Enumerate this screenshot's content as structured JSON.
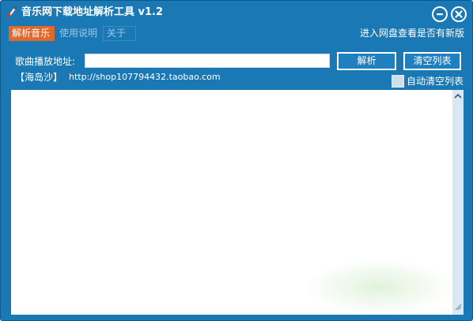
{
  "window": {
    "title": "音乐网下载地址解析工具 v1.2",
    "colors": {
      "frame": "#1a78b4",
      "active_tab": "#e0682a",
      "list_bg": "#ffffff"
    }
  },
  "title_controls": {
    "minimize_icon": "minimize-icon",
    "close_icon": "close-icon"
  },
  "tabs": [
    {
      "label": "解析音乐",
      "active": true
    },
    {
      "label": "使用说明",
      "active": false
    },
    {
      "label": "关于",
      "active": false
    }
  ],
  "update_link": "进入网盘查看是否有新版",
  "form": {
    "url_label": "歌曲播放地址:",
    "url_value": "",
    "parse_button": "解析",
    "clear_button": "清空列表"
  },
  "shop": {
    "name": "【海岛沙】",
    "url": "http://shop107794432.taobao.com"
  },
  "auto_clear": {
    "label": "自动清空列表",
    "checked": false
  }
}
